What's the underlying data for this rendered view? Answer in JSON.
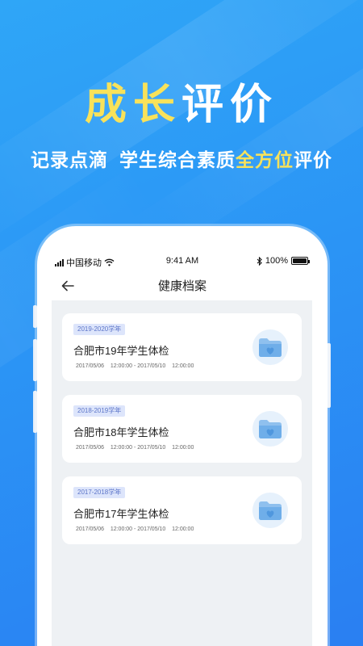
{
  "promo": {
    "headline_yellow": "成长",
    "headline_white": "评价",
    "sub_part1": "记录点滴",
    "sub_part2": "学生综合素质",
    "sub_highlight": "全方位",
    "sub_part3": "评价",
    "accent_color": "#f8e25a",
    "background_color": "#2b95f5"
  },
  "status_bar": {
    "carrier": "中国移动",
    "time": "9:41 AM",
    "battery": "100%",
    "icons": [
      "signal-icon",
      "wifi-icon",
      "bluetooth-icon",
      "battery-icon"
    ]
  },
  "nav": {
    "title": "健康档案",
    "back_icon": "back-arrow-icon"
  },
  "records": [
    {
      "year": "2019-2020学年",
      "title": "合肥市19年学生体检",
      "time": "2017/05/06    12:00:00 - 2017/05/10    12:00:00",
      "icon": "folder-heart-icon"
    },
    {
      "year": "2018-2019学年",
      "title": "合肥市18年学生体检",
      "time": "2017/05/06    12:00:00 - 2017/05/10    12:00:00",
      "icon": "folder-heart-icon"
    },
    {
      "year": "2017-2018学年",
      "title": "合肥市17年学生体检",
      "time": "2017/05/06    12:00:00 - 2017/05/10    12:00:00",
      "icon": "folder-heart-icon"
    }
  ]
}
